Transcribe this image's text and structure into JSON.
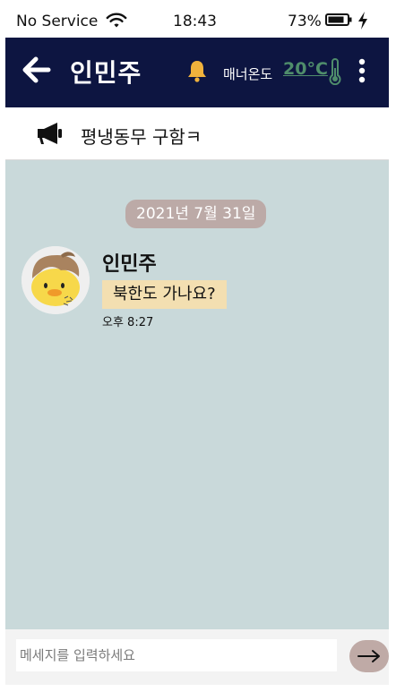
{
  "status_bar": {
    "carrier": "No Service",
    "time": "18:43",
    "battery_percent": "73%",
    "icons": [
      "wifi-icon",
      "battery-icon",
      "charging-bolt-icon"
    ]
  },
  "header": {
    "title": "인민주",
    "manner_label": "매너온도",
    "manner_temp": "20°C",
    "icons": [
      "back-arrow-icon",
      "bell-icon",
      "thermometer-icon",
      "more-vertical-icon"
    ]
  },
  "notice": {
    "text": "평냉동무 구함ㅋ",
    "icon": "megaphone-icon"
  },
  "chat": {
    "date": "2021년 7월 31일",
    "messages": [
      {
        "sender": "인민주",
        "text": "북한도 가나요?",
        "time": "오후 8:27"
      }
    ]
  },
  "composer": {
    "placeholder": "메세지를 입력하세요",
    "value": "",
    "send_icon": "send-arrow-icon"
  },
  "colors": {
    "header_bg": "#0d1541",
    "chat_bg": "#c9d9da",
    "date_pill_bg": "#bcaaa7",
    "bubble_bg": "#f3dfb1",
    "manner_temp": "#4f8d6b",
    "bell": "#f0b23c",
    "send_button_bg": "#bfaaa6"
  }
}
